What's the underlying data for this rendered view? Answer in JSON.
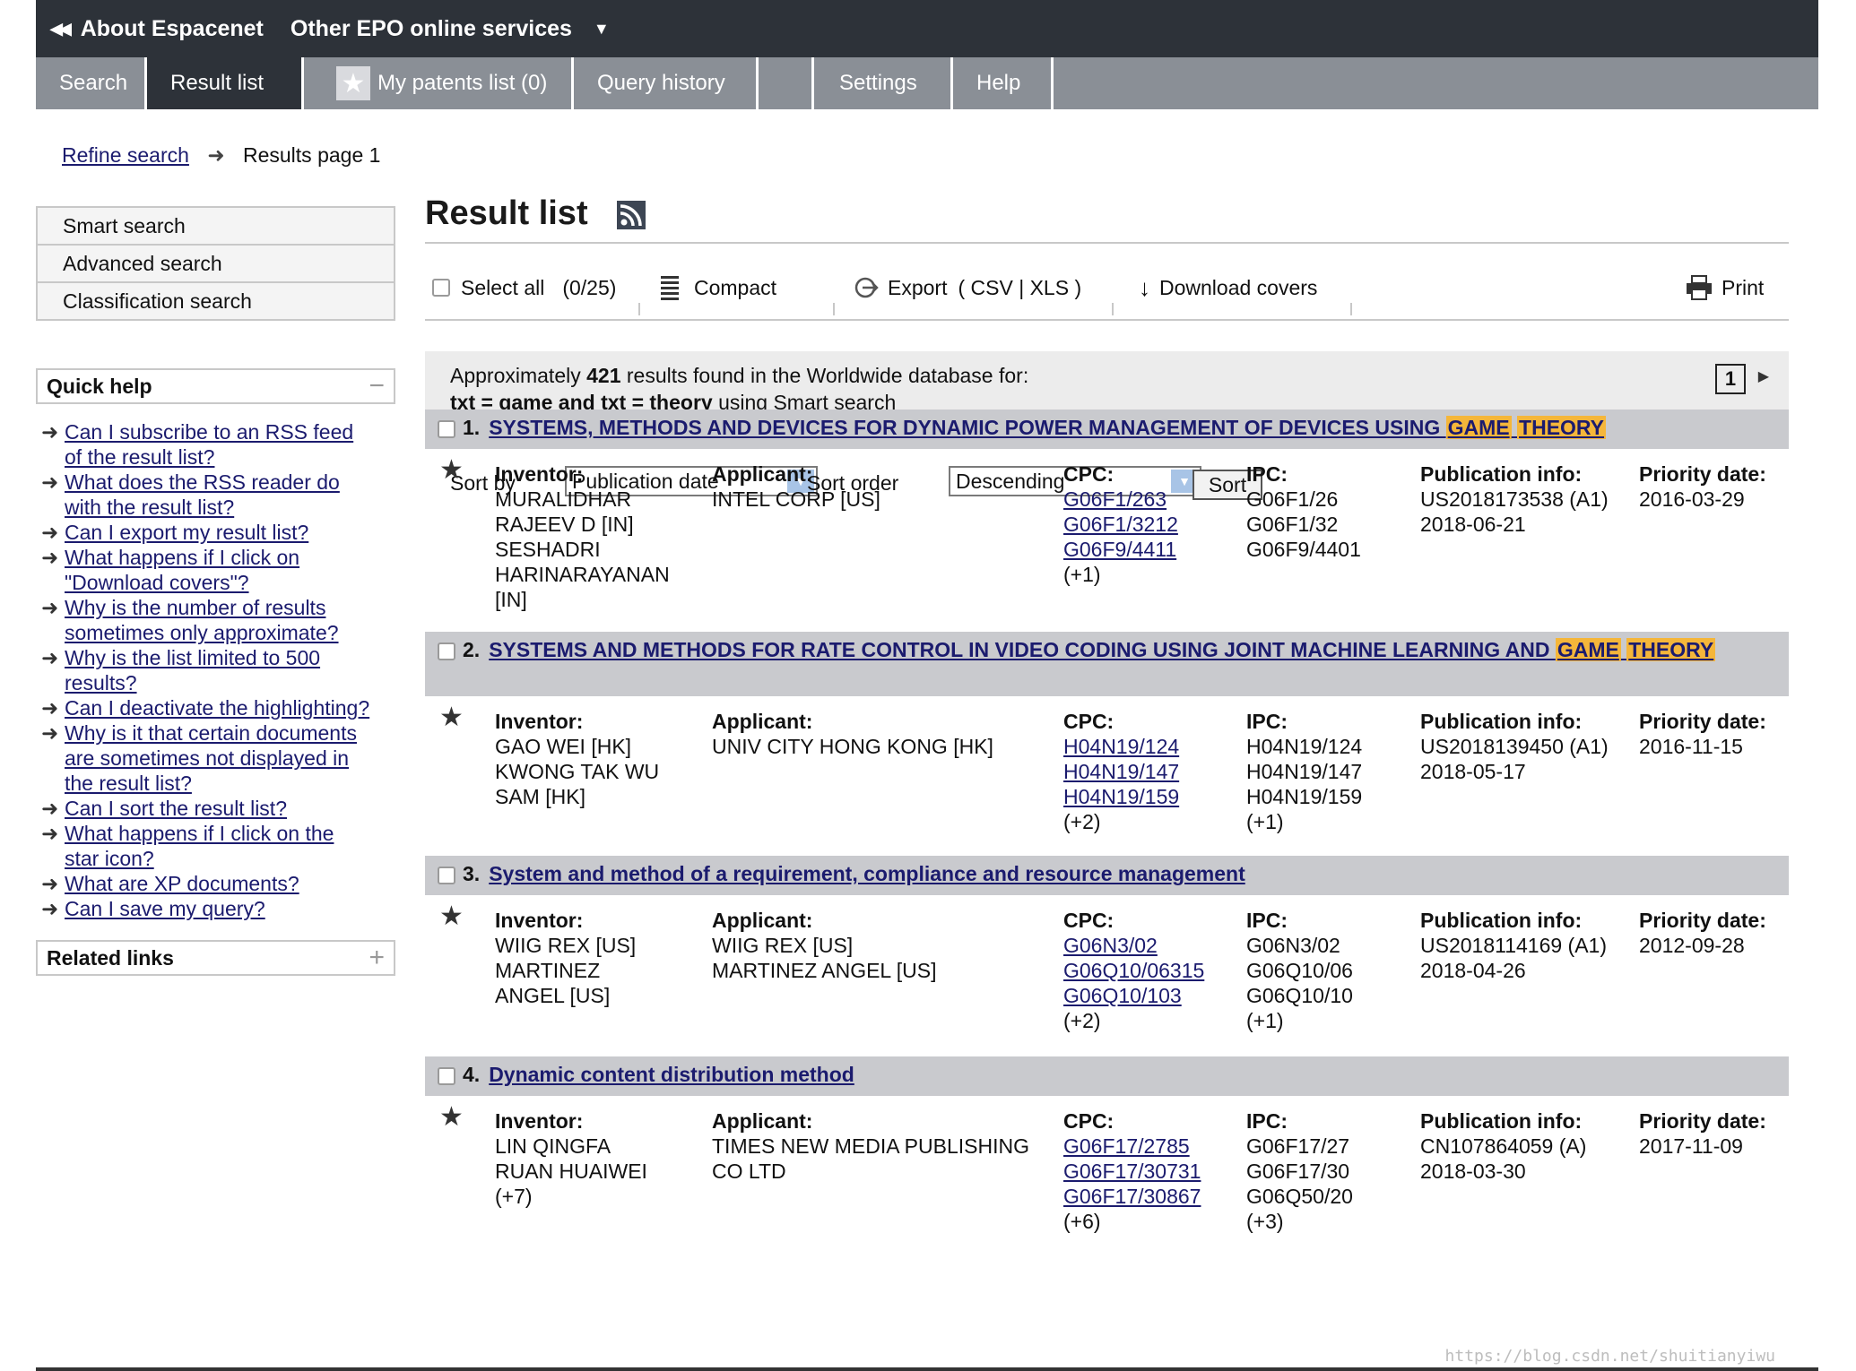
{
  "topbar": {
    "about": "About Espacenet",
    "other": "Other EPO online services"
  },
  "tabs": [
    {
      "label": "Search"
    },
    {
      "label": "Result list"
    },
    {
      "label": "My patents list (0)"
    },
    {
      "label": "Query history"
    },
    {
      "label": "Settings"
    },
    {
      "label": "Help"
    }
  ],
  "breadcrumb": {
    "refine": "Refine search",
    "current": "Results page 1"
  },
  "sidenav": [
    "Smart search",
    "Advanced search",
    "Classification search"
  ],
  "quick_help": {
    "title": "Quick help",
    "toggle": "−",
    "items": [
      [
        "Can I subscribe to an RSS feed",
        "of the result list?"
      ],
      [
        "What does the RSS reader do",
        "with the result list?"
      ],
      [
        "Can I export my result list?"
      ],
      [
        "What happens if I click on",
        "\"Download covers\"?"
      ],
      [
        "Why is the number of results",
        "sometimes only approximate?"
      ],
      [
        "Why is the list limited to 500",
        "results?"
      ],
      [
        "Can I deactivate the highlighting?"
      ],
      [
        "Why is it that certain documents",
        "are sometimes not displayed in",
        "the result list?"
      ],
      [
        "Can I sort the result list?"
      ],
      [
        "What happens if I click on the",
        "star icon?"
      ],
      [
        "What are XP documents?"
      ],
      [
        "Can I save my query?"
      ]
    ]
  },
  "related": {
    "title": "Related links",
    "toggle": "+"
  },
  "main": {
    "title": "Result list",
    "toolbar": {
      "select_all": "Select all",
      "count": "(0/25)",
      "compact": "Compact",
      "export": "Export",
      "export_formats": "( CSV | XLS )",
      "download": "Download covers",
      "print": "Print"
    },
    "summary": {
      "prefix": "Approximately",
      "count": "421",
      "suffix": "results found in the Worldwide database for:",
      "query": "txt = game and txt = theory",
      "query_suffix": "using Smart search",
      "page": "1"
    },
    "sort": {
      "by_label": "Sort by",
      "by_value": "Publication date",
      "order_label": "Sort order",
      "order_value": "Descending",
      "button": "Sort"
    }
  },
  "col_headers": {
    "inventor": "Inventor:",
    "applicant": "Applicant:",
    "cpc": "CPC:",
    "ipc": "IPC:",
    "pub": "Publication info:",
    "priority": "Priority date:"
  },
  "results": [
    {
      "num": "1.",
      "title_parts": [
        "SYSTEMS, METHODS AND DEVICES FOR DYNAMIC POWER MANAGEMENT OF DEVICES USING ",
        "GAME",
        " ",
        "THEORY",
        ""
      ],
      "inventor": [
        "MURALIDHAR",
        "RAJEEV D  [IN]",
        "SESHADRI",
        "HARINARAYANAN",
        "[IN]"
      ],
      "applicant": [
        "INTEL CORP  [US]"
      ],
      "cpc": [
        "G06F1/263",
        "G06F1/3212",
        "G06F9/4411"
      ],
      "cpc_more": "(+1)",
      "ipc": [
        "G06F1/26",
        "G06F1/32",
        "G06F9/4401"
      ],
      "ipc_more": "",
      "pub": [
        "US2018173538 (A1)",
        "2018-06-21"
      ],
      "priority": "2016-03-29"
    },
    {
      "num": "2.",
      "title_parts": [
        "SYSTEMS AND METHODS FOR RATE CONTROL IN VIDEO CODING USING JOINT MACHINE LEARNING AND ",
        "GAME",
        " ",
        "THEORY",
        ""
      ],
      "inventor": [
        "GAO WEI  [HK]",
        "KWONG TAK WU",
        "SAM  [HK]"
      ],
      "applicant": [
        "UNIV CITY HONG KONG  [HK]"
      ],
      "cpc": [
        "H04N19/124",
        "H04N19/147",
        "H04N19/159"
      ],
      "cpc_more": "(+2)",
      "ipc": [
        "H04N19/124",
        "H04N19/147",
        "H04N19/159"
      ],
      "ipc_more": "(+1)",
      "pub": [
        "US2018139450 (A1)",
        "2018-05-17"
      ],
      "priority": "2016-11-15"
    },
    {
      "num": "3.",
      "title_parts": [
        "System and method of a requirement, compliance and resource management"
      ],
      "inventor": [
        "WIIG REX  [US]",
        "MARTINEZ",
        "ANGEL  [US]"
      ],
      "applicant": [
        "WIIG REX  [US]",
        "MARTINEZ ANGEL  [US]"
      ],
      "cpc": [
        "G06N3/02",
        "G06Q10/06315",
        "G06Q10/103"
      ],
      "cpc_more": "(+2)",
      "ipc": [
        "G06N3/02",
        "G06Q10/06",
        "G06Q10/10"
      ],
      "ipc_more": "(+1)",
      "pub": [
        "US2018114169 (A1)",
        "2018-04-26"
      ],
      "priority": "2012-09-28"
    },
    {
      "num": "4.",
      "title_parts": [
        "Dynamic content distribution method"
      ],
      "inventor": [
        "LIN QINGFA",
        "RUAN HUAIWEI",
        "(+7)"
      ],
      "applicant": [
        "TIMES NEW MEDIA PUBLISHING",
        "CO LTD"
      ],
      "cpc": [
        "G06F17/2785",
        "G06F17/30731",
        "G06F17/30867"
      ],
      "cpc_more": "(+6)",
      "ipc": [
        "G06F17/27",
        "G06F17/30",
        "G06Q50/20"
      ],
      "ipc_more": "(+3)",
      "pub": [
        "CN107864059 (A)",
        "2018-03-30"
      ],
      "priority": "2017-11-09"
    }
  ],
  "watermark": "https://blog.csdn.net/shuitianyiwu",
  "colors": {
    "topbar": "#2d3239",
    "tabbar": "#8a8f96",
    "highlight": "#f5b63a",
    "result_header": "#c9cace",
    "link": "#1b1b6e"
  }
}
